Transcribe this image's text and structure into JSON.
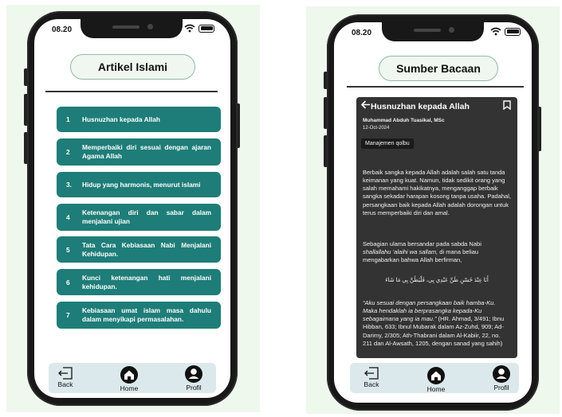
{
  "left_phone": {
    "time": "08.20",
    "title": "Artikel Islami",
    "articles": [
      {
        "num": "1",
        "text": "Husnuzhan kepada Allah"
      },
      {
        "num": "2",
        "text": "Memperbaiki diri sesuai dengan ajaran Agama Allah"
      },
      {
        "num": "3.",
        "text": "Hidup yang harmonis, menurut islami"
      },
      {
        "num": "4",
        "text": "Ketenangan diri dan sabar dalam menjalani ujian"
      },
      {
        "num": "5",
        "text": "Tata Cara Kebiasaan Nabi Menjalani Kehidupan."
      },
      {
        "num": "6",
        "text": "Kunci ketenangan hati menjalani kehidupan."
      },
      {
        "num": "7",
        "text": "Kebiasaan umat islam masa dahulu dalam menyikapi permasalahan."
      }
    ],
    "nav": {
      "back": "Back",
      "home": "Home",
      "profil": "Profil"
    }
  },
  "right_phone": {
    "time": "08.20",
    "title": "Sumber Bacaan",
    "card": {
      "title": "Husnuzhan kepada Allah",
      "author": "Muhammad Abduh Tuasikal, MSc",
      "date": "12-Oct-2024",
      "tag": "Manajemen qolbu",
      "para1": "Berbaik sangka kepada Allah adalah salah satu tanda keimanan yang kuat. Namun, tidak sedikit orang yang salah memahami hakikatnya, menganggap berbaik sangka sekadar harapan kosong tanpa usaha. Padahal, persangkaan baik kepada Allah adalah dorongan untuk terus memperbaiki diri dan amal.",
      "para2_a": "Sebagian ulama bersandar pada sabda Nabi ",
      "para2_italic": "shallallahu ‘alaihi wa sallam,",
      "para2_b": " di mana beliau mengabarkan bahwa Allah berfirman,",
      "arabic": "أَنَا عِنْدَ حُسْنِ ظَنِّ عَبْدِي بِي، فَلْيَظُنَّ بِي مَا شَاءَ",
      "quote_italic": "“Aku sesuai dengan persangkaan baik hamba-Ku. Maka hendaklah ia berprasangka kepada-Ku sebagaimana yang ia mau.”",
      "quote_rest": " (HR. Ahmad, 3/491; Ibnu Hibban, 633; Ibnul Mubarak dalam Az-Zuhd, 909; Ad-Darimy, 2/305; Ath-Thabrani dalam Al-Kabiir, 22, no. 211 dan Al-Awsath, 1205, dengan sanad yang sahih)"
    },
    "nav": {
      "back": "Back",
      "home": "Home",
      "profil": "Profil"
    }
  },
  "colors": {
    "article_bg": "#1e7d78",
    "card_bg": "#333333",
    "panel_bg": "#eef8ec",
    "navbar_bg": "#dce9ec"
  }
}
